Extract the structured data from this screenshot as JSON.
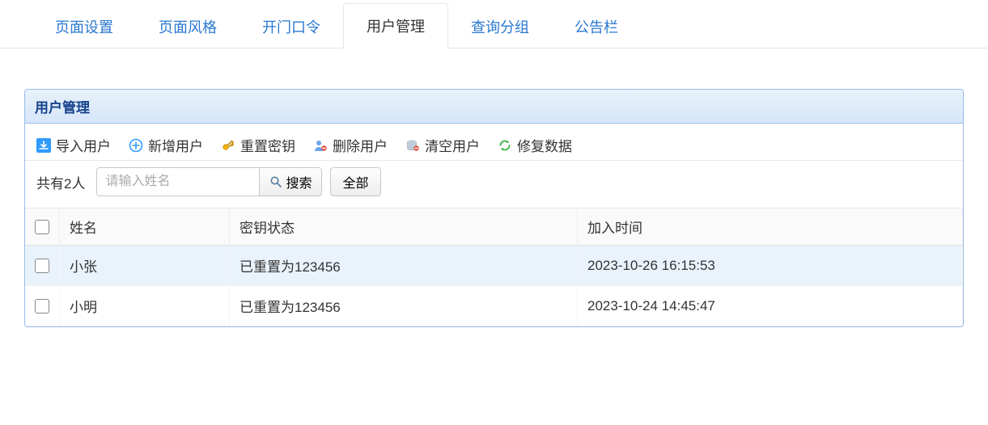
{
  "nav": {
    "tabs": [
      {
        "label": "页面设置"
      },
      {
        "label": "页面风格"
      },
      {
        "label": "开门口令"
      },
      {
        "label": "用户管理"
      },
      {
        "label": "查询分组"
      },
      {
        "label": "公告栏"
      }
    ],
    "active_index": 3
  },
  "panel": {
    "title": "用户管理"
  },
  "toolbar": {
    "import_label": "导入用户",
    "add_label": "新增用户",
    "reset_key_label": "重置密钥",
    "delete_label": "删除用户",
    "clear_label": "清空用户",
    "repair_label": "修复数据"
  },
  "filter": {
    "count_text": "共有2人",
    "search_placeholder": "请输入姓名",
    "search_label": "搜索",
    "all_label": "全部"
  },
  "table": {
    "columns": {
      "name": "姓名",
      "key_status": "密钥状态",
      "join_time": "加入时间"
    },
    "rows": [
      {
        "name": "小张",
        "key_status": "已重置为123456",
        "join_time": "2023-10-26 16:15:53",
        "selected": true
      },
      {
        "name": "小明",
        "key_status": "已重置为123456",
        "join_time": "2023-10-24 14:45:47",
        "selected": false
      }
    ]
  },
  "icons": {
    "import": "import-icon",
    "add": "plus-circle-icon",
    "reset_key": "key-icon",
    "delete": "user-delete-icon",
    "clear": "database-clear-icon",
    "repair": "refresh-icon",
    "search": "magnifier-icon"
  }
}
